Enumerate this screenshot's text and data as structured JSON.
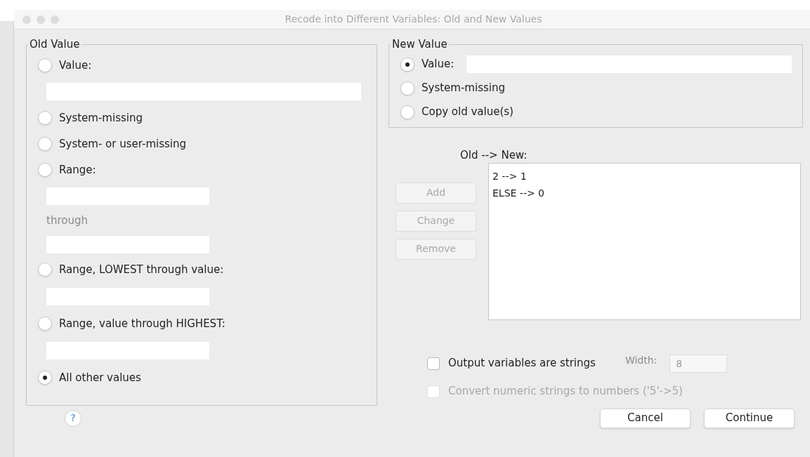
{
  "window": {
    "title": "Recode into Different Variables: Old and New Values"
  },
  "old_value": {
    "title": "Old Value",
    "options": [
      {
        "kind": "radio_field",
        "label": "Value:",
        "selected": false
      },
      {
        "kind": "radio",
        "label": "System-missing",
        "selected": false
      },
      {
        "kind": "radio",
        "label": "System- or user-missing",
        "selected": false
      },
      {
        "kind": "radio_range",
        "label": "Range:",
        "through_label": "through",
        "selected": false
      },
      {
        "kind": "radio_short_field",
        "label": "Range, LOWEST through value:",
        "selected": false
      },
      {
        "kind": "radio_short_field",
        "label": "Range, value through HIGHEST:",
        "selected": false
      },
      {
        "kind": "radio",
        "label": "All other values",
        "selected": true
      }
    ]
  },
  "new_value": {
    "title": "New Value",
    "options": [
      {
        "kind": "radio_inline_field",
        "label": "Value:",
        "selected": true
      },
      {
        "kind": "radio",
        "label": "System-missing",
        "selected": false
      },
      {
        "kind": "radio",
        "label": "Copy old value(s)",
        "selected": false
      }
    ]
  },
  "mapping": {
    "label": "Old --> New:",
    "items": [
      "2 --> 1",
      "ELSE --> 0"
    ]
  },
  "mapping_buttons": [
    {
      "label": "Add",
      "disabled": true
    },
    {
      "label": "Change",
      "disabled": true
    },
    {
      "label": "Remove",
      "disabled": true
    }
  ],
  "string_output": {
    "label": "Output variables are strings",
    "checked": false,
    "disabled": false
  },
  "width": {
    "label": "Width:",
    "value": "8",
    "disabled": true
  },
  "convert_numeric": {
    "label": "Convert numeric strings to numbers ('5'->5)",
    "checked": false,
    "disabled": true
  },
  "help": {
    "label": "?"
  },
  "footer_buttons": [
    {
      "label": "Cancel"
    },
    {
      "label": "Continue"
    }
  ]
}
